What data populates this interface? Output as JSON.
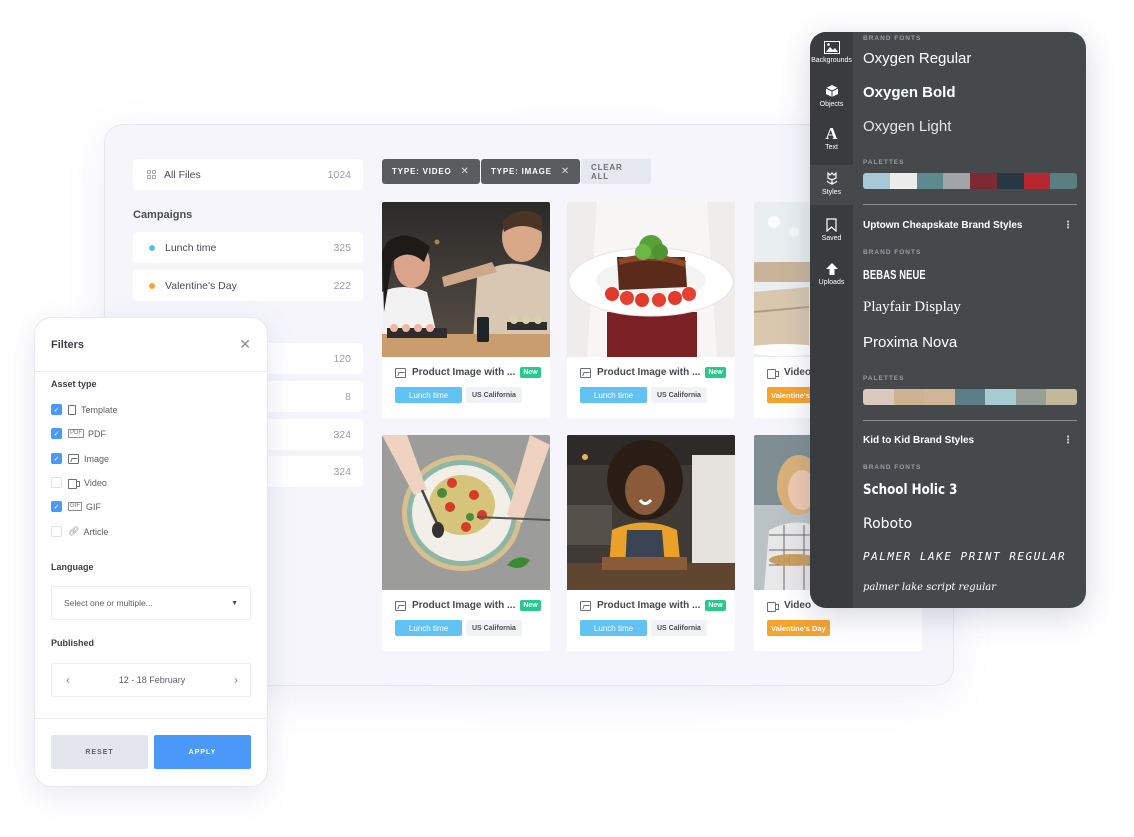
{
  "library": {
    "all_files": {
      "label": "All Files",
      "count": "1024",
      "icon": "grid-icon"
    },
    "campaigns_heading": "Campaigns",
    "campaigns": [
      {
        "label": "Lunch time",
        "count": "325",
        "color": "#5bc1f5"
      },
      {
        "label": "Valentine's Day",
        "count": "222",
        "color": "#f7a32c"
      }
    ],
    "other_counts": [
      "120",
      "8",
      "324",
      "324"
    ],
    "filter_chips": [
      {
        "label": "TYPE: VIDEO",
        "remove_icon": "close-icon"
      },
      {
        "label": "TYPE: IMAGE",
        "remove_icon": "close-icon"
      }
    ],
    "clear_all": "CLEAR ALL",
    "cards": [
      {
        "photo": "couple-dining-sushi",
        "type_icon": "image-icon",
        "title": "Product Image with ...",
        "badge": "New",
        "campaign_tag": "Lunch time",
        "location_tag": "US California"
      },
      {
        "photo": "plated-steak-tomatoes",
        "type_icon": "image-icon",
        "title": "Product Image with ...",
        "badge": "New",
        "campaign_tag": "Lunch time",
        "location_tag": "US California"
      },
      {
        "photo": "table-setting-napkin",
        "type_icon": "video-icon",
        "title": "Video",
        "campaign_tag": "Valentine's Day"
      },
      {
        "photo": "pasta-plate-overhead",
        "type_icon": "image-icon",
        "title": "Product Image with ...",
        "badge": "New",
        "campaign_tag": "Lunch time",
        "location_tag": "US California"
      },
      {
        "photo": "smiling-barista-apron",
        "type_icon": "image-icon",
        "title": "Product Image with ...",
        "badge": "New",
        "campaign_tag": "Lunch time",
        "location_tag": "US California"
      },
      {
        "photo": "woman-serving-food",
        "type_icon": "video-icon",
        "title": "Video",
        "campaign_tag": "Valentine's Day"
      }
    ]
  },
  "filters": {
    "title": "Filters",
    "close_icon": "close-icon",
    "asset_type_label": "Asset type",
    "asset_types": [
      {
        "label": "Template",
        "checked": true,
        "icon": "template-icon"
      },
      {
        "label": "PDF",
        "checked": true,
        "icon": "pdf-icon"
      },
      {
        "label": "Image",
        "checked": true,
        "icon": "image-icon"
      },
      {
        "label": "Video",
        "checked": false,
        "icon": "video-icon"
      },
      {
        "label": "GIF",
        "checked": true,
        "icon": "gif-icon"
      },
      {
        "label": "Article",
        "checked": false,
        "icon": "link-icon"
      }
    ],
    "language_label": "Language",
    "language_placeholder": "Select one or multiple...",
    "published_label": "Published",
    "published_value": "12 - 18 February",
    "reset": "RESET",
    "apply": "APPLY",
    "accent": "#4a98f7"
  },
  "brand_panel": {
    "rail": [
      {
        "label": "Backgrounds",
        "icon": "image-icon"
      },
      {
        "label": "Objects",
        "icon": "cube-icon"
      },
      {
        "label": "Text",
        "icon": "text-icon"
      },
      {
        "label": "Styles",
        "icon": "styles-icon",
        "active": true
      },
      {
        "label": "Saved",
        "icon": "bookmark-icon"
      },
      {
        "label": "Uploads",
        "icon": "upload-arrow-icon"
      }
    ],
    "kits": [
      {
        "title": "",
        "brand_fonts_label": "BRAND FONTS",
        "fonts": [
          "Oxygen Regular",
          "Oxygen Bold",
          "Oxygen Light"
        ],
        "palettes_label": "PALETTES",
        "palette": [
          "#a7c8d7",
          "#ececec",
          "#5d8a8e",
          "#a2a5a8",
          "#7e2a33",
          "#253843",
          "#b6272f",
          "#5a7f82"
        ]
      },
      {
        "title": "Uptown Cheapskate Brand Styles",
        "brand_fonts_label": "BRAND FONTS",
        "fonts": [
          "BEBAS NEUE",
          "Playfair Display",
          "Proxima Nova"
        ],
        "palettes_label": "PALETTES",
        "palette": [
          "#dcc9bd",
          "#cfb292",
          "#d0b596",
          "#5c7e88",
          "#a6cdd1",
          "#96a096",
          "#c2b89b"
        ]
      },
      {
        "title": "Kid to Kid Brand Styles",
        "brand_fonts_label": "BRAND FONTS",
        "fonts": [
          "School Holic 3",
          "Roboto",
          "PALMER LAKE PRINT REGULAR",
          "palmer lake script regular"
        ]
      }
    ]
  }
}
